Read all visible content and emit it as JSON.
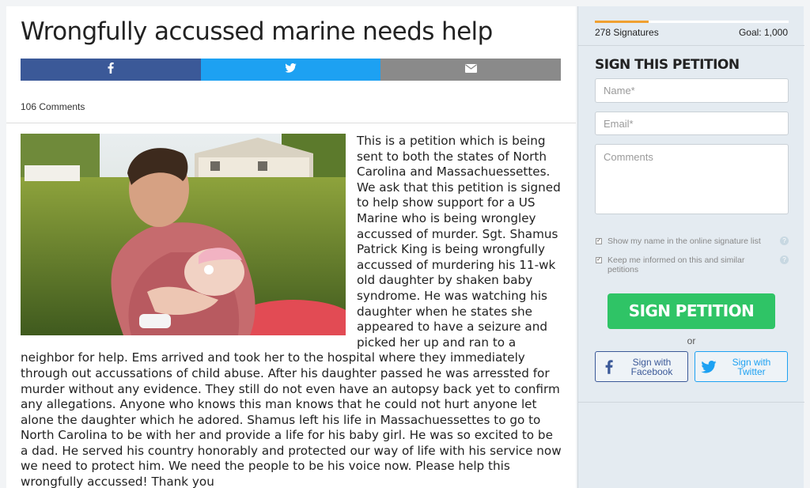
{
  "petition": {
    "title": "Wrongfully accussed marine needs help",
    "comments_count": "106 Comments",
    "body": "This is a petition which is being sent to both the states of North Carolina and Massachuessettes. We ask that this petition is signed to help show support for a US Marine who is being wrongley accussed of murder. Sgt. Shamus Patrick King is being wrongfully accussed of murdering his 11-wk old daughter by shaken baby syndrome. He was watching his daughter when he states she appeared to have a seizure and picked her up and ran to a neighbor for help. Ems arrived and took her to the hospital where they immediately through out accussations of child abuse. After his daughter passed he was arressted for murder without any evidence. They still do not even have an autopsy back yet to confirm any allegations. Anyone who knows this man knows that he could not hurt anyone let alone the daughter which he adored. Shamus left his life in Massachuessettes to go to North Carolina to be with her and provide a life for his baby girl. He was so excited to be a dad. He served his country honorably and protected our way of life with his service now we need to protect him. We need the people to be his voice now. Please help this wrongfully accussed! Thank you"
  },
  "share": {
    "facebook_icon": "facebook-icon",
    "twitter_icon": "twitter-icon",
    "email_icon": "envelope-icon",
    "colors": {
      "facebook": "#3b5998",
      "twitter": "#1da1f2",
      "email": "#8a8a8a"
    }
  },
  "sidebar": {
    "signatures": "278 Signatures",
    "goal": "Goal: 1,000",
    "progress_fraction": 0.278,
    "sign_title": "SIGN THIS PETITION",
    "name_placeholder": "Name*",
    "email_placeholder": "Email*",
    "comments_placeholder": "Comments",
    "show_name_label": "Show my name in the online signature list",
    "keep_informed_label": "Keep me informed on this and similar petitions",
    "sign_button": "SIGN PETITION",
    "or_text": "or",
    "sign_facebook_label": "Sign with Facebook",
    "sign_twitter_label": "Sign with Twitter",
    "colors": {
      "sign_button": "#2fc466",
      "progress": "#f0a030"
    }
  }
}
